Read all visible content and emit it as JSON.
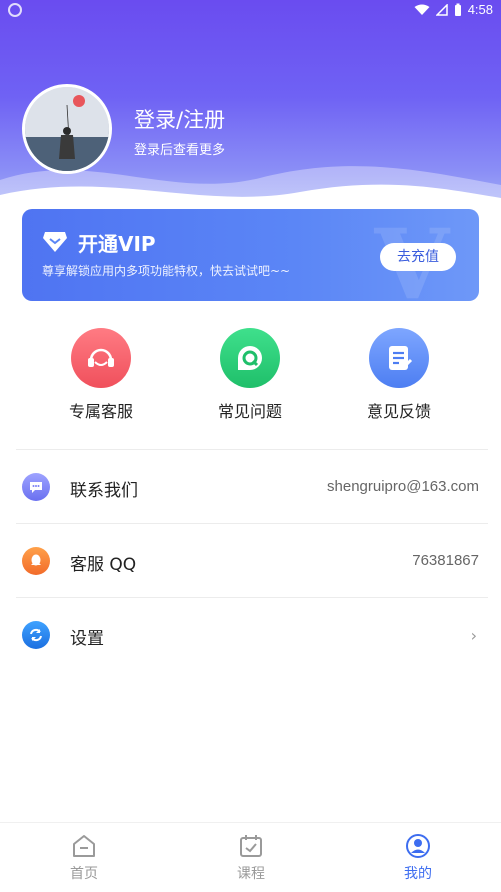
{
  "status_bar": {
    "time": "4:58"
  },
  "profile": {
    "title": "登录/注册",
    "subtitle": "登录后查看更多"
  },
  "vip": {
    "title": "开通VIP",
    "description": "尊享解锁应用内多项功能特权，快去试试吧~~",
    "button": "去充值",
    "watermark": "V"
  },
  "quick_actions": [
    {
      "label": "专属客服",
      "icon": "headset-icon",
      "color": "#f0505c"
    },
    {
      "label": "常见问题",
      "icon": "faq-q-icon",
      "color": "#1fbf6a"
    },
    {
      "label": "意见反馈",
      "icon": "feedback-note-icon",
      "color": "#4d7ef2"
    }
  ],
  "list": [
    {
      "label": "联系我们",
      "value": "shengruipro@163.com",
      "icon": "chat-icon"
    },
    {
      "label": "客服 QQ",
      "value": "76381867",
      "icon": "qq-icon"
    },
    {
      "label": "设置",
      "value": "",
      "icon": "settings-sync-icon"
    }
  ],
  "tabs": [
    {
      "label": "首页",
      "icon": "home-icon",
      "active": false
    },
    {
      "label": "课程",
      "icon": "calendar-check-icon",
      "active": false
    },
    {
      "label": "我的",
      "icon": "user-icon",
      "active": true
    }
  ],
  "colors": {
    "accent": "#3d6df0",
    "header_top": "#6a4cf0",
    "vip_card": "#5b86f6"
  }
}
